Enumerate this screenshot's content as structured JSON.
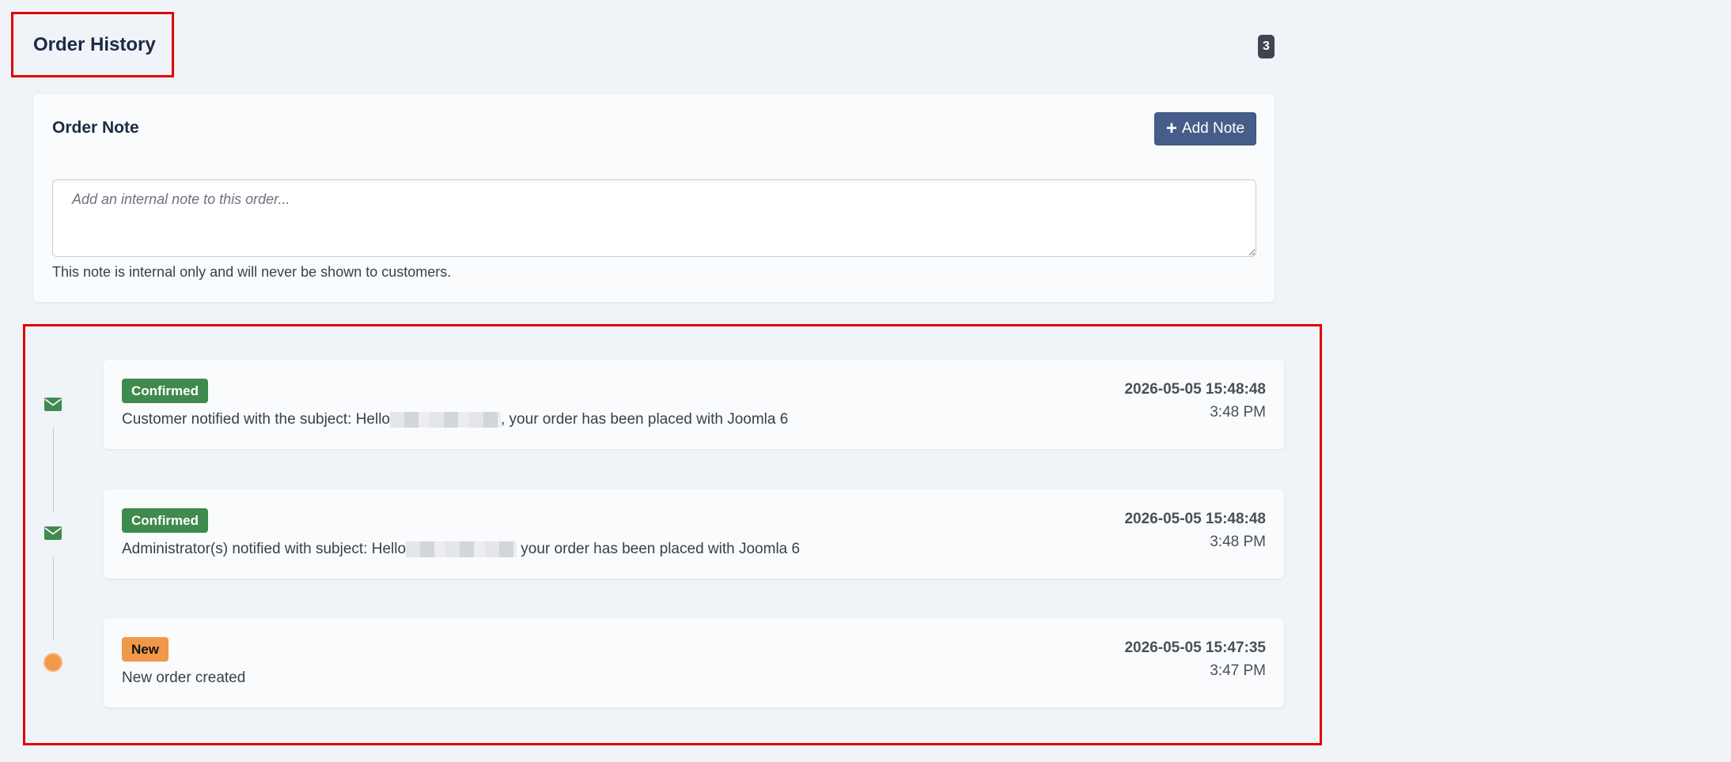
{
  "header": {
    "title": "Order History",
    "count": "3"
  },
  "note": {
    "title": "Order Note",
    "add_button_label": "Add Note",
    "placeholder": "Add an internal note to this order...",
    "help_text": "This note is internal only and will never be shown to customers."
  },
  "timeline": [
    {
      "status": "Confirmed",
      "status_color": "#3f8a4d",
      "icon": "envelope-icon",
      "message_prefix": "Customer notified with the subject: Hello",
      "message_suffix": ", your order has been placed with Joomla 6",
      "date": "2026-05-05 15:48:48",
      "time": "3:48 PM"
    },
    {
      "status": "Confirmed",
      "status_color": "#3f8a4d",
      "icon": "envelope-icon",
      "message_prefix": "Administrator(s) notified with subject: Hello",
      "message_suffix": " your order has been placed with Joomla 6",
      "date": "2026-05-05 15:48:48",
      "time": "3:48 PM"
    },
    {
      "status": "New",
      "status_color": "#f0994b",
      "icon": "dot-icon",
      "message_prefix": "New order created",
      "message_suffix": "",
      "date": "2026-05-05 15:47:35",
      "time": "3:47 PM"
    }
  ],
  "colors": {
    "accent": "#475d89",
    "highlight": "#e00000",
    "confirmed": "#3f8a4d",
    "new": "#f0994b"
  }
}
